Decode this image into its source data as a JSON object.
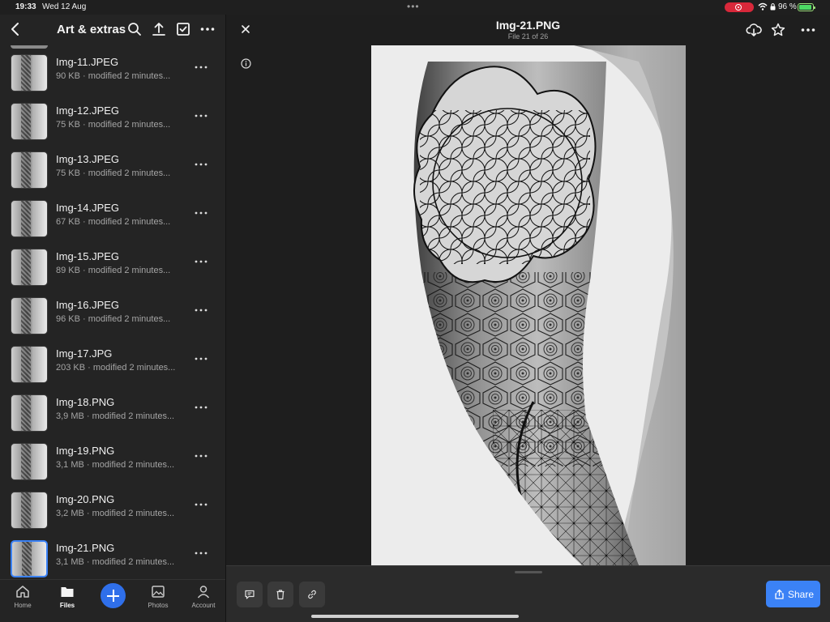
{
  "status": {
    "time": "19:33",
    "date": "Wed 12 Aug",
    "battery_pct": "96 %",
    "battery_level": 0.96
  },
  "sidebar": {
    "title": "Art & extras",
    "files": [
      {
        "name": "Img-11.JPEG",
        "meta": "90 KB · modified 2 minutes..."
      },
      {
        "name": "Img-12.JPEG",
        "meta": "75 KB · modified 2 minutes..."
      },
      {
        "name": "Img-13.JPEG",
        "meta": "75 KB · modified 2 minutes..."
      },
      {
        "name": "Img-14.JPEG",
        "meta": "67 KB · modified 2 minutes..."
      },
      {
        "name": "Img-15.JPEG",
        "meta": "89 KB · modified 2 minutes..."
      },
      {
        "name": "Img-16.JPEG",
        "meta": "96 KB · modified 2 minutes..."
      },
      {
        "name": "Img-17.JPG",
        "meta": "203 KB · modified 2 minutes..."
      },
      {
        "name": "Img-18.PNG",
        "meta": "3,9 MB · modified 2 minutes..."
      },
      {
        "name": "Img-19.PNG",
        "meta": "3,1 MB · modified 2 minutes..."
      },
      {
        "name": "Img-20.PNG",
        "meta": "3,2 MB · modified 2 minutes..."
      },
      {
        "name": "Img-21.PNG",
        "meta": "3,1 MB · modified 2 minutes..."
      }
    ],
    "tabs": {
      "home": "Home",
      "files": "Files",
      "photos": "Photos",
      "account": "Account"
    }
  },
  "viewer": {
    "title": "Img-21.PNG",
    "subtitle": "File 21 of 26",
    "share_label": "Share"
  },
  "colors": {
    "accent": "#3b82f6",
    "record": "#d8283a",
    "battery": "#4cd964"
  }
}
